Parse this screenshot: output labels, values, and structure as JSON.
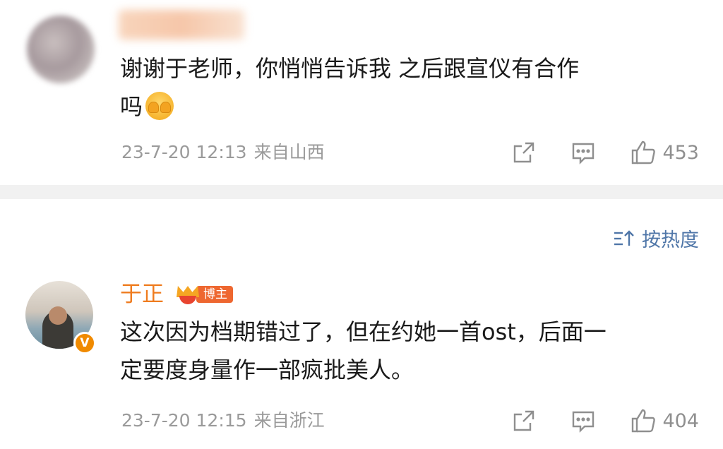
{
  "comments": [
    {
      "username": "",
      "text_line1": "谢谢于老师，你悄悄告诉我 之后跟宣仪有合作",
      "text_line2": "吗",
      "emoji": "cover-face-emoji",
      "time": "23-7-20 12:13",
      "location": "来自山西",
      "likes": "453"
    },
    {
      "username": "于正",
      "badge": "博主",
      "verified": "V",
      "text_line1": "这次因为档期错过了，但在约她一首ost，后面一",
      "text_line2": "定要度身量作一部疯批美人。",
      "time": "23-7-20 12:15",
      "location": "来自浙江",
      "likes": "404"
    }
  ],
  "sort": {
    "label": "按热度",
    "icon": "sort-icon"
  },
  "icons": [
    "share-icon",
    "reply-icon",
    "like-icon",
    "crown-icon"
  ],
  "colors": {
    "username": "#ef7c1f",
    "meta": "#9a9a9a",
    "sort_link": "#4f76a8",
    "badge": "#ee6730",
    "verified": "#f08a00"
  }
}
